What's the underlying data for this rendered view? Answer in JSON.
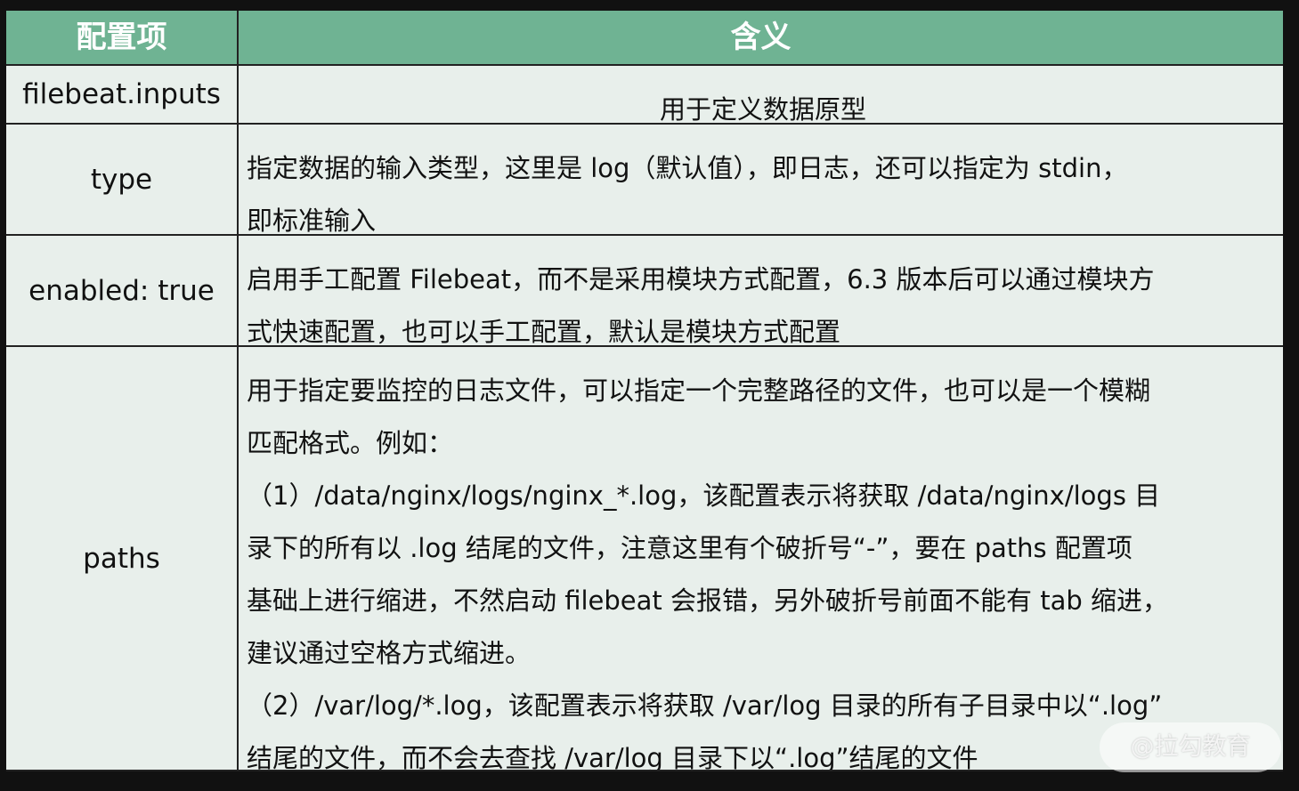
{
  "header": {
    "col1": "配置项",
    "col2": "含义"
  },
  "rows": [
    {
      "key": "filebeat.inputs",
      "lines": [
        "用于定义数据原型"
      ]
    },
    {
      "key": "type",
      "lines": [
        "指定数据的输入类型，这里是 log（默认值），即日志，还可以指定为 stdin，",
        "即标准输入"
      ]
    },
    {
      "key": "enabled: true",
      "lines": [
        "启用手工配置 Filebeat，而不是采用模块方式配置，6.3 版本后可以通过模块方",
        "式快速配置，也可以手工配置，默认是模块方式配置"
      ]
    },
    {
      "key": "paths",
      "lines": [
        "用于指定要监控的日志文件，可以指定一个完整路径的文件，也可以是一个模糊",
        "匹配格式。例如：",
        "（1）/data/nginx/logs/nginx_*.log，该配置表示将获取 /data/nginx/logs 目",
        "录下的所有以 .log 结尾的文件，注意这里有个破折号“-”，要在 paths 配置项",
        "基础上进行缩进，不然启动 filebeat 会报错，另外破折号前面不能有 tab 缩进，",
        "建议通过空格方式缩进。",
        "（2）/var/log/*.log，该配置表示将获取 /var/log 目录的所有子目录中以“.log”",
        "结尾的文件，而不会去查找 /var/log 目录下以“.log”结尾的文件"
      ]
    }
  ],
  "watermark": "@拉勾教育",
  "colors": {
    "header_bg": "#6fb393",
    "cell_bg": "#e8efeb",
    "border": "#222222"
  }
}
